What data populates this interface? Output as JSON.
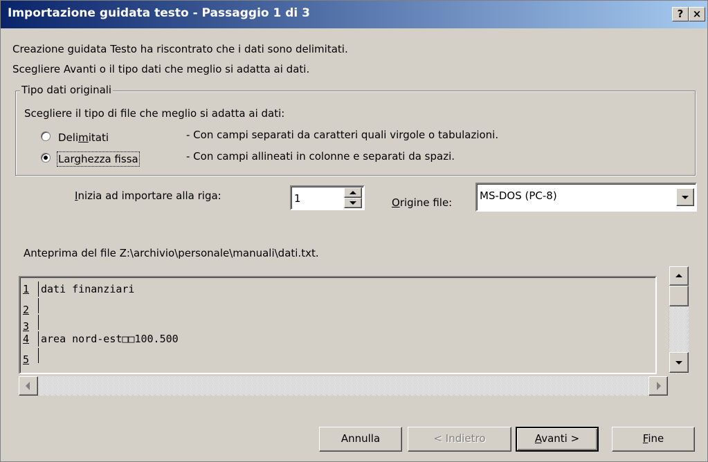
{
  "window": {
    "title": "Importazione guidata testo - Passaggio 1 di 3",
    "help_label": "?",
    "close_label": "×"
  },
  "intro": {
    "line1": "Creazione guidata Testo ha riscontrato che i dati sono delimitati.",
    "line2": "Scegliere Avanti o il tipo dati che meglio si adatta ai dati."
  },
  "group": {
    "legend": "Tipo dati originali",
    "prompt": "Scegliere il tipo di file che meglio si adatta ai dati:",
    "options": [
      {
        "label_pre": "Deli",
        "label_u": "m",
        "label_post": "itati",
        "description": "- Con campi separati da caratteri quali virgole o tabulazioni.",
        "selected": false
      },
      {
        "label_pre": "Lar",
        "label_u": "g",
        "label_post": "hezza fissa",
        "description": "- Con campi allineati in colonne e separati da spazi.",
        "selected": true
      }
    ]
  },
  "start_row": {
    "label_u": "I",
    "label_rest": "nizia ad importare alla riga:",
    "value": "1"
  },
  "file_origin": {
    "label_u": "O",
    "label_rest": "rigine file:",
    "value": "MS-DOS (PC-8)"
  },
  "preview": {
    "caption": "Anteprima del file Z:\\archivio\\personale\\manuali\\dati.txt.",
    "rows": [
      {
        "num": "1",
        "text": "dati finanziari"
      },
      {
        "num": "2",
        "text": ""
      },
      {
        "num": "3",
        "text": ""
      },
      {
        "num": "4",
        "text": "area nord-est□□100.500"
      },
      {
        "num": "5",
        "text": ""
      }
    ]
  },
  "buttons": {
    "cancel": {
      "label": "Annulla"
    },
    "back": {
      "label": "< Indietro",
      "enabled": false
    },
    "next": {
      "label_u": "A",
      "label_rest": "vanti >"
    },
    "finish": {
      "label_u": "F",
      "label_rest": "ine"
    }
  },
  "colors": {
    "titlebar_start": "#0a246a",
    "titlebar_end": "#a6caf0",
    "face": "#d4d0c8"
  }
}
